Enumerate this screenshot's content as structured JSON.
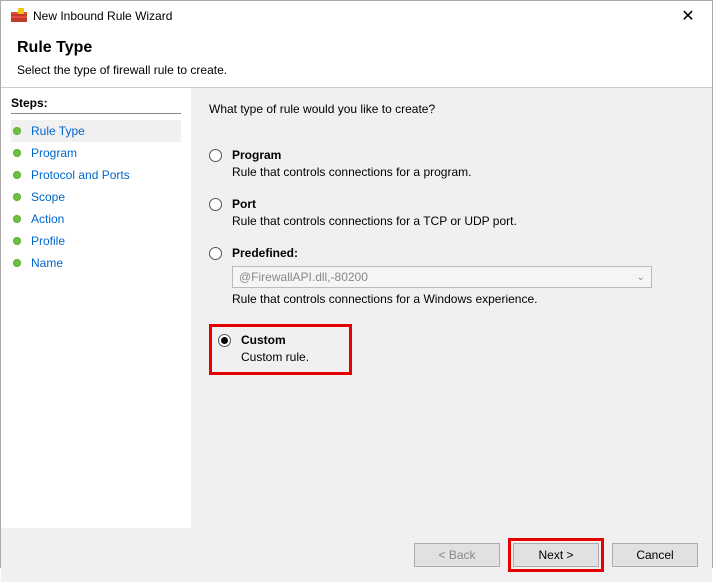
{
  "window": {
    "title": "New Inbound Rule Wizard"
  },
  "header": {
    "title": "Rule Type",
    "subtitle": "Select the type of firewall rule to create."
  },
  "sidebar": {
    "title": "Steps:",
    "items": [
      {
        "label": "Rule Type"
      },
      {
        "label": "Program"
      },
      {
        "label": "Protocol and Ports"
      },
      {
        "label": "Scope"
      },
      {
        "label": "Action"
      },
      {
        "label": "Profile"
      },
      {
        "label": "Name"
      }
    ]
  },
  "main": {
    "question": "What type of rule would you like to create?",
    "options": {
      "program": {
        "title": "Program",
        "desc": "Rule that controls connections for a program."
      },
      "port": {
        "title": "Port",
        "desc": "Rule that controls connections for a TCP or UDP port."
      },
      "predefined": {
        "title": "Predefined:",
        "dropdown": "@FirewallAPI.dll,-80200",
        "desc": "Rule that controls connections for a Windows experience."
      },
      "custom": {
        "title": "Custom",
        "desc": "Custom rule."
      }
    }
  },
  "buttons": {
    "back": "< Back",
    "next": "Next >",
    "cancel": "Cancel"
  }
}
